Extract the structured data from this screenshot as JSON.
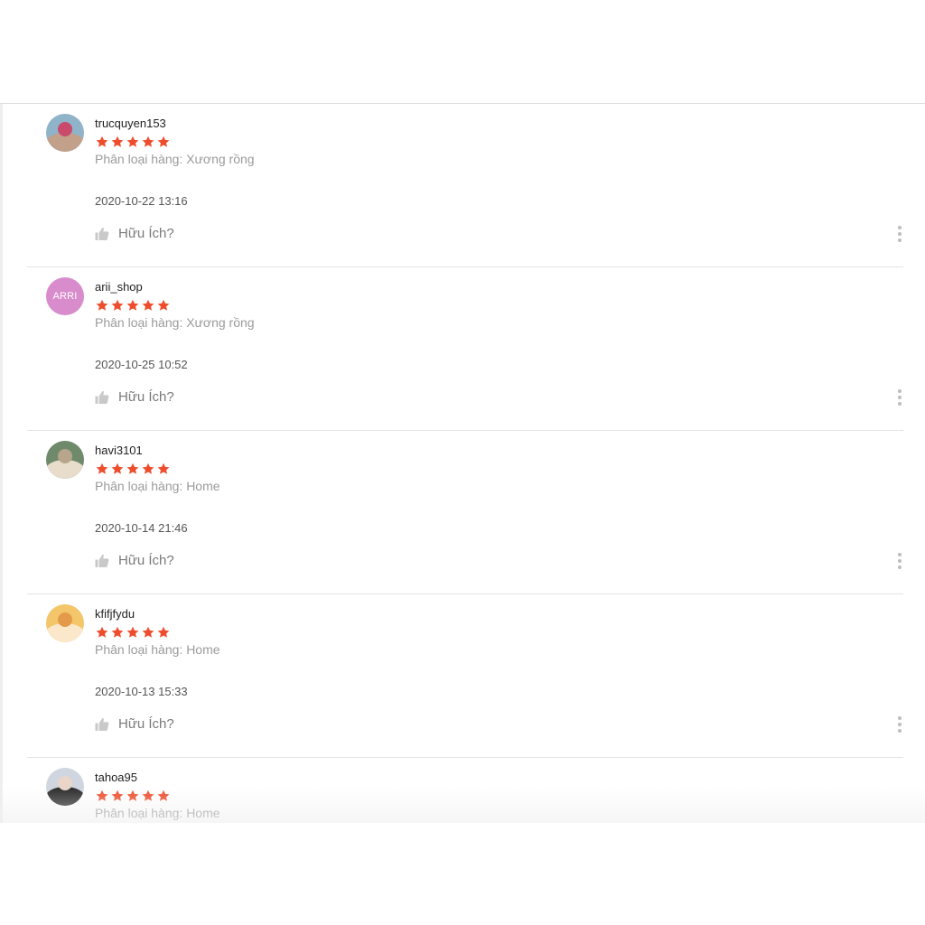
{
  "reviews": [
    {
      "username": "trucquyen153",
      "rating": 5,
      "variant": "Phân loại hàng: Xương rồng",
      "date": "2020-10-22 13:16",
      "helpful_label": "Hữu Ích?",
      "avatar": {
        "type": "photo",
        "colors": [
          "#8fb3c9",
          "#c2a08a",
          "#c94a6b"
        ]
      }
    },
    {
      "username": "arii_shop",
      "rating": 5,
      "variant": "Phân loại hàng: Xương rồng",
      "date": "2020-10-25 10:52",
      "helpful_label": "Hữu Ích?",
      "avatar": {
        "type": "initials",
        "text": "ARRI",
        "color": "#d98ccc"
      }
    },
    {
      "username": "havi3101",
      "rating": 5,
      "variant": "Phân loại hàng: Home",
      "date": "2020-10-14 21:46",
      "helpful_label": "Hữu Ích?",
      "avatar": {
        "type": "photo",
        "colors": [
          "#6f8a6a",
          "#e8dccb",
          "#b7a58c"
        ]
      }
    },
    {
      "username": "kfifjfydu",
      "rating": 5,
      "variant": "Phân loại hàng: Home",
      "date": "2020-10-13 15:33",
      "helpful_label": "Hữu Ích?",
      "avatar": {
        "type": "photo",
        "colors": [
          "#f3c66a",
          "#fbe7c9",
          "#e49a4a"
        ]
      }
    },
    {
      "username": "tahoa95",
      "rating": 5,
      "variant": "Phân loại hàng: Home",
      "date": "",
      "helpful_label": "",
      "avatar": {
        "type": "photo",
        "colors": [
          "#cfd6df",
          "#2b2b2b",
          "#e9d6c8"
        ]
      }
    }
  ],
  "colors": {
    "star": "#ee4d2d",
    "muted": "#9b9b9b",
    "divider": "#e4e4e4"
  },
  "icons": {
    "star": "star-icon",
    "thumb": "thumb-up-icon",
    "more": "more-vertical-icon"
  }
}
